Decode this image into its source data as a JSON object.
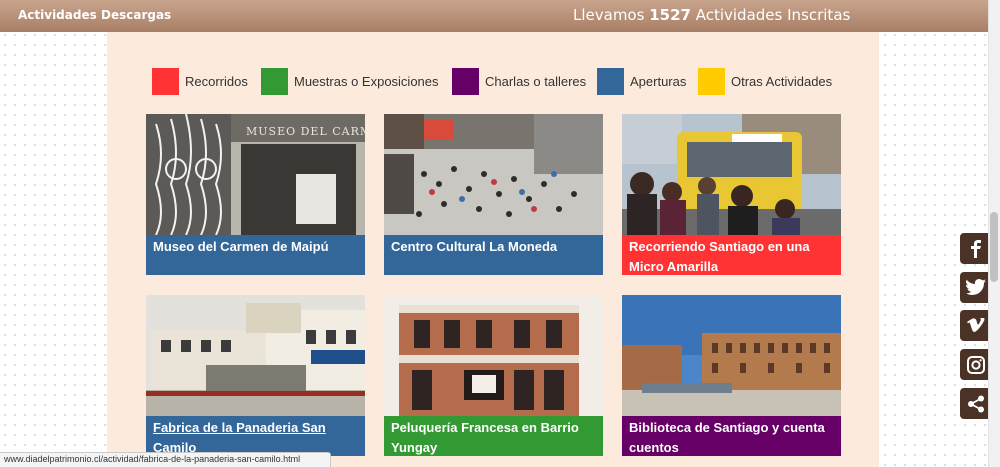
{
  "nav": {
    "actividades": "Actividades",
    "descargas": "Descargas",
    "counter_prefix": "Llevamos ",
    "counter_number": "1527",
    "counter_suffix": " Actividades Inscritas"
  },
  "legend": [
    {
      "label": "Recorridos",
      "color": "#ff3333"
    },
    {
      "label": "Muestras o Exposiciones",
      "color": "#339933"
    },
    {
      "label": "Charlas o talleres",
      "color": "#660066"
    },
    {
      "label": "Aperturas",
      "color": "#336699"
    },
    {
      "label": "Otras Actividades",
      "color": "#ffcc00"
    }
  ],
  "cards": [
    {
      "title": "Museo del Carmen de Maipú",
      "color": "#336699",
      "photo": "museum-gate-photo"
    },
    {
      "title": "Centro Cultural La Moneda",
      "color": "#336699",
      "photo": "crowd-atrium-photo"
    },
    {
      "title": "Recorriendo Santiago en una Micro Amarilla",
      "color": "#ff3333",
      "photo": "yellow-bus-photo"
    },
    {
      "title": "Fabrica de la Panaderia San Camilo",
      "color": "#336699",
      "photo": "bakery-corner-photo"
    },
    {
      "title": "Peluquería Francesa en Barrio Yungay",
      "color": "#339933",
      "photo": "peluqueria-building-photo"
    },
    {
      "title": "Biblioteca de Santiago y cuenta cuentos",
      "color": "#660066",
      "photo": "library-building-photo"
    }
  ],
  "museum_sign": "MUSEO DEL CARMEN",
  "status_url": "www.diadelpatrimonio.cl/actividad/fabrica-de-la-panaderia-san-camilo.html",
  "social": [
    "facebook-icon",
    "twitter-icon",
    "vimeo-icon",
    "instagram-icon",
    "share-icon"
  ]
}
